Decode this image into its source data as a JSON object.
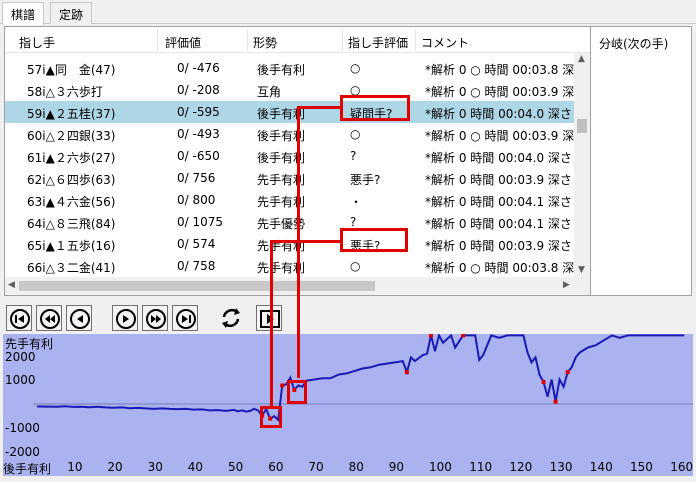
{
  "tabs": [
    {
      "label": "棋譜",
      "active": true
    },
    {
      "label": "定跡",
      "active": false
    }
  ],
  "columns": {
    "move": "指し手",
    "eval": "評価値",
    "situation": "形勢",
    "move_eval": "指し手評価",
    "comment": "コメント"
  },
  "rows": [
    {
      "move": "57i▲同　金(47)",
      "eval": "0/  -476",
      "situation": "後手有利",
      "move_eval": "○",
      "comment": "*解析 0 ○ 時間 00:03.8 深"
    },
    {
      "move": "58i△３六歩打",
      "eval": "0/  -208",
      "situation": "互角",
      "move_eval": "○",
      "comment": "*解析 0 ○ 時間 00:03.9 深"
    },
    {
      "move": "59i▲２五桂(37)",
      "eval": "0/  -595",
      "situation": "後手有利",
      "move_eval": "疑問手?",
      "comment": "*解析 0  時間 00:04.0 深さ"
    },
    {
      "move": "60i△２四銀(33)",
      "eval": "0/  -493",
      "situation": "後手有利",
      "move_eval": "○",
      "comment": "*解析 0 ○ 時間 00:03.9 深"
    },
    {
      "move": "61i▲２六歩(27)",
      "eval": "0/  -650",
      "situation": "後手有利",
      "move_eval": "?",
      "comment": "*解析 0  時間 00:04.0 深さ"
    },
    {
      "move": "62i△６四歩(63)",
      "eval": "0/   756",
      "situation": "先手有利",
      "move_eval": "悪手?",
      "comment": "*解析 0  時間 00:03.9 深さ"
    },
    {
      "move": "63i▲４六金(56)",
      "eval": "0/   800",
      "situation": "先手有利",
      "move_eval": "・",
      "comment": "*解析 0  時間 00:04.1 深さ"
    },
    {
      "move": "64i△８三飛(84)",
      "eval": "0/  1075",
      "situation": "先手優勢",
      "move_eval": "?",
      "comment": "*解析 0  時間 00:04.1 深さ"
    },
    {
      "move": "65i▲１五歩(16)",
      "eval": "0/   574",
      "situation": "先手有利",
      "move_eval": "悪手?",
      "comment": "*解析 0  時間 00:03.9 深さ"
    },
    {
      "move": "66i△３二金(41)",
      "eval": "0/   758",
      "situation": "先手有利",
      "move_eval": "○",
      "comment": "*解析 0 ○ 時間 00:03.8 深"
    }
  ],
  "selected_row": 2,
  "branch_panel": {
    "title": "分岐(次の手)"
  },
  "toolbar": {
    "buttons": [
      "first-icon",
      "back-many-icon",
      "back-icon",
      "forward-icon",
      "forward-many-icon",
      "last-icon",
      "flip-board-icon",
      "play-icon"
    ]
  },
  "graph": {
    "top_label": "先手有利",
    "bottom_label": "後手有利",
    "y_labels": [
      "2000",
      "1000",
      "-1000",
      "-2000"
    ],
    "x_ticks": [
      "10",
      "20",
      "30",
      "40",
      "50",
      "60",
      "70",
      "80",
      "90",
      "100",
      "110",
      "120",
      "130",
      "140",
      "150",
      "160"
    ],
    "line_color": "#1a1ab4",
    "background_color": "#aab2f0",
    "marker_color": "#e00000",
    "series": [
      [
        1,
        -100
      ],
      [
        6,
        -110
      ],
      [
        8,
        -90
      ],
      [
        10,
        -120
      ],
      [
        12,
        -110
      ],
      [
        14,
        -130
      ],
      [
        16,
        -115
      ],
      [
        18,
        -140
      ],
      [
        20,
        -150
      ],
      [
        22,
        -140
      ],
      [
        24,
        -170
      ],
      [
        26,
        -160
      ],
      [
        28,
        -180
      ],
      [
        30,
        -200
      ],
      [
        32,
        -180
      ],
      [
        34,
        -200
      ],
      [
        36,
        -210
      ],
      [
        38,
        -200
      ],
      [
        40,
        -230
      ],
      [
        42,
        -220
      ],
      [
        44,
        -260
      ],
      [
        46,
        -250
      ],
      [
        48,
        -280
      ],
      [
        50,
        -240
      ],
      [
        51,
        -300
      ],
      [
        52,
        -260
      ],
      [
        53,
        -310
      ],
      [
        54,
        -280
      ],
      [
        55,
        -200
      ],
      [
        56,
        -260
      ],
      [
        57,
        -476
      ],
      [
        58,
        -208
      ],
      [
        59,
        -595
      ],
      [
        60,
        -493
      ],
      [
        61,
        -650
      ],
      [
        62,
        756
      ],
      [
        63,
        800
      ],
      [
        64,
        1075
      ],
      [
        65,
        574
      ],
      [
        66,
        758
      ],
      [
        67,
        700
      ],
      [
        68,
        950
      ],
      [
        70,
        1000
      ],
      [
        72,
        1050
      ],
      [
        74,
        1050
      ],
      [
        76,
        1200
      ],
      [
        78,
        1250
      ],
      [
        80,
        1350
      ],
      [
        82,
        1450
      ],
      [
        84,
        1500
      ],
      [
        86,
        1600
      ],
      [
        88,
        1650
      ],
      [
        90,
        1700
      ],
      [
        92,
        1750
      ],
      [
        93,
        1300
      ],
      [
        94,
        1900
      ],
      [
        95,
        1750
      ],
      [
        97,
        2000
      ],
      [
        98,
        2050
      ],
      [
        99,
        2800
      ],
      [
        100,
        2150
      ],
      [
        101,
        2800
      ],
      [
        102,
        2500
      ],
      [
        104,
        2800
      ],
      [
        105,
        2300
      ],
      [
        107,
        2800
      ],
      [
        110,
        2800
      ],
      [
        111,
        1800
      ],
      [
        112,
        2000
      ],
      [
        114,
        2800
      ],
      [
        116,
        2700
      ],
      [
        118,
        2800
      ],
      [
        120,
        2800
      ],
      [
        122,
        2800
      ],
      [
        123,
        2100
      ],
      [
        124,
        1700
      ],
      [
        125,
        1900
      ],
      [
        126,
        1200
      ],
      [
        127,
        900
      ],
      [
        128,
        300
      ],
      [
        129,
        1000
      ],
      [
        130,
        100
      ],
      [
        131,
        1000
      ],
      [
        132,
        700
      ],
      [
        133,
        1300
      ],
      [
        134,
        1500
      ],
      [
        135,
        1900
      ],
      [
        136,
        2100
      ],
      [
        138,
        2300
      ],
      [
        140,
        2400
      ],
      [
        142,
        2600
      ],
      [
        144,
        2800
      ],
      [
        146,
        2700
      ],
      [
        148,
        2800
      ],
      [
        150,
        2800
      ],
      [
        155,
        2800
      ],
      [
        162,
        2800
      ]
    ]
  }
}
